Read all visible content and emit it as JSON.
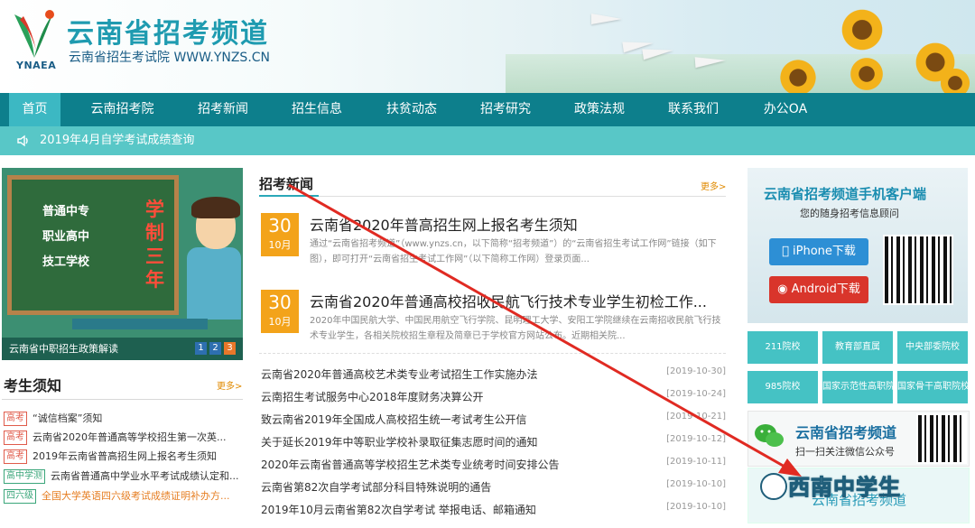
{
  "header": {
    "logo_caption": "YNAEA",
    "title": "云南省招考频道",
    "subtitle": "云南省招生考试院 WWW.YNZS.CN"
  },
  "nav": {
    "items": [
      {
        "label": "首页",
        "active": true
      },
      {
        "label": "云南招考院"
      },
      {
        "label": "招考新闻"
      },
      {
        "label": "招生信息"
      },
      {
        "label": "扶贫动态"
      },
      {
        "label": "招考研究"
      },
      {
        "label": "政策法规"
      },
      {
        "label": "联系我们"
      },
      {
        "label": "办公OA"
      }
    ]
  },
  "notice": {
    "icon": "speaker-icon",
    "text": "2019年4月自学考试成绩查询"
  },
  "banner": {
    "board_lines": [
      "普通中专",
      "职业高中",
      "技工学校"
    ],
    "board_red": "学制三年",
    "caption": "云南省中职招生政策解读",
    "pages": [
      "1",
      "2",
      "3"
    ],
    "active_page": "3"
  },
  "kaosheng": {
    "title": "考生须知",
    "more": "更多>",
    "items": [
      {
        "tag": "高考",
        "text": "“诚信档案”须知",
        "color": "#333333",
        "tag_style": "red"
      },
      {
        "tag": "高考",
        "text": "云南省2020年普通高等学校招生第一次英...",
        "color": "#333333",
        "tag_style": "red"
      },
      {
        "tag": "高考",
        "text": "2019年云南省普高招生网上报名考生须知",
        "color": "#333333",
        "tag_style": "red"
      },
      {
        "tag": "高中学测",
        "text": "云南省普通高中学业水平考试成绩认定和...",
        "color": "#333333",
        "tag_style": "green"
      },
      {
        "tag": "四六级",
        "text": "全国大学英语四六级考试成绩证明补办方...",
        "color": "#e67e22",
        "tag_style": "green"
      }
    ]
  },
  "news": {
    "title": "招考新闻",
    "more": "更多>",
    "featured": [
      {
        "day": "30",
        "month": "10月",
        "title": "云南省2020年普高招生网上报名考生须知",
        "summary": "通过“云南省招考频道”（www.ynzs.cn，以下简称“招考频道”）的“云南省招生考试工作网”链接（如下图），即可打开“云南省招生考试工作网”（以下简称工作网）登录页面..."
      },
      {
        "day": "30",
        "month": "10月",
        "title": "云南省2020年普通高校招收民航飞行技术专业学生初检工作...",
        "summary": "2020年中国民航大学、中国民用航空飞行学院、昆明理工大学、安阳工学院继续在云南招收民航飞行技术专业学生，各相关院校招生章程及简章已于学校官方网站公布。近期相关院..."
      }
    ],
    "list": [
      {
        "text": "云南省2020年普通高校艺术类专业考试招生工作实施办法",
        "date": "[2019-10-30]"
      },
      {
        "text": "云南招生考试服务中心2018年度财务决算公开",
        "date": "[2019-10-24]"
      },
      {
        "text": "致云南省2019年全国成人高校招生统一考试考生公开信",
        "date": "[2019-10-21]"
      },
      {
        "text": "关于延长2019年中等职业学校补录取征集志愿时间的通知",
        "date": "[2019-10-12]"
      },
      {
        "text": "2020年云南省普通高等学校招生艺术类专业统考时间安排公告",
        "date": "[2019-10-11]"
      },
      {
        "text": "云南省第82次自学考试部分科目特殊说明的通告",
        "date": "[2019-10-10]"
      },
      {
        "text": "2019年10月云南省第82次自学考试 举报电话、邮箱通知",
        "date": "[2019-10-10]"
      }
    ]
  },
  "app": {
    "title": "云南省招考频道手机客户端",
    "subtitle": "您的随身招考信息顾问",
    "iphone_label": "iPhone下载",
    "android_label": "Android下载",
    "iphone_color": "#2d8fd5",
    "android_color": "#d9352b"
  },
  "links": [
    {
      "label": "211院校"
    },
    {
      "label": "教育部直属"
    },
    {
      "label": "中央部委院校"
    },
    {
      "label": "985院校"
    },
    {
      "label": "国家示范性高职院"
    },
    {
      "label": "国家骨干高职院校"
    }
  ],
  "weixin": {
    "title": "云南省招考频道",
    "subtitle": "扫一扫关注微信公众号"
  },
  "watermark": "西南中学生",
  "bottom_box_text": "云南省招考频道"
}
